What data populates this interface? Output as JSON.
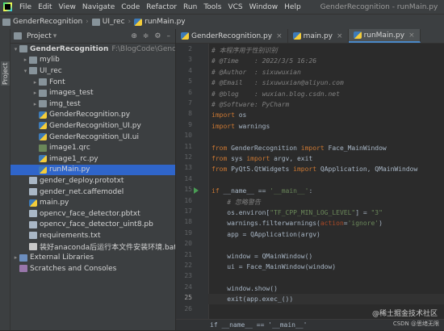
{
  "menubar": {
    "items": [
      "File",
      "Edit",
      "View",
      "Navigate",
      "Code",
      "Refactor",
      "Run",
      "Tools",
      "VCS",
      "Window",
      "Help"
    ],
    "window_title": "GenderRecognition - runMain.py"
  },
  "navbar": {
    "crumbs": [
      "GenderRecognition",
      "UI_rec",
      "runMain.py"
    ]
  },
  "side_strip": {
    "label": "Project"
  },
  "project": {
    "title": "Project",
    "root_name": "GenderRecognition",
    "root_path": "F:\\BlogCode\\GenderRecogn",
    "tree": [
      {
        "label": "mylib",
        "type": "folder",
        "indent": 2,
        "arrow": "▸"
      },
      {
        "label": "UI_rec",
        "type": "folder",
        "indent": 2,
        "arrow": "▾"
      },
      {
        "label": "Font",
        "type": "folder",
        "indent": 3,
        "arrow": "▸"
      },
      {
        "label": "images_test",
        "type": "folder",
        "indent": 3,
        "arrow": "▸"
      },
      {
        "label": "img_test",
        "type": "folder",
        "indent": 3,
        "arrow": "▸"
      },
      {
        "label": "GenderRecognition.py",
        "type": "py",
        "indent": 3,
        "arrow": ""
      },
      {
        "label": "GenderRecognition_UI.py",
        "type": "py",
        "indent": 3,
        "arrow": ""
      },
      {
        "label": "GenderRecognition_UI.ui",
        "type": "py",
        "indent": 3,
        "arrow": ""
      },
      {
        "label": "image1.qrc",
        "type": "qrc",
        "indent": 3,
        "arrow": ""
      },
      {
        "label": "image1_rc.py",
        "type": "py",
        "indent": 3,
        "arrow": ""
      },
      {
        "label": "runMain.py",
        "type": "py",
        "indent": 3,
        "arrow": "",
        "selected": true
      },
      {
        "label": "gender_deploy.prototxt",
        "type": "txt",
        "indent": 2,
        "arrow": ""
      },
      {
        "label": "gender_net.caffemodel",
        "type": "txt",
        "indent": 2,
        "arrow": ""
      },
      {
        "label": "main.py",
        "type": "py",
        "indent": 2,
        "arrow": ""
      },
      {
        "label": "opencv_face_detector.pbtxt",
        "type": "txt",
        "indent": 2,
        "arrow": ""
      },
      {
        "label": "opencv_face_detector_uint8.pb",
        "type": "txt",
        "indent": 2,
        "arrow": ""
      },
      {
        "label": "requirements.txt",
        "type": "txt",
        "indent": 2,
        "arrow": ""
      },
      {
        "label": "装好anaconda后运行本文件安装环境.bat",
        "type": "bat",
        "indent": 2,
        "arrow": ""
      },
      {
        "label": "External Libraries",
        "type": "lib",
        "indent": 1,
        "arrow": "▸"
      },
      {
        "label": "Scratches and Consoles",
        "type": "cons",
        "indent": 1,
        "arrow": ""
      }
    ]
  },
  "editor": {
    "tabs": [
      {
        "label": "GenderRecognition.py",
        "active": false
      },
      {
        "label": "main.py",
        "active": false
      },
      {
        "label": "runMain.py",
        "active": true
      }
    ],
    "lines": [
      {
        "no": "2",
        "html": "<span class='c-com'># 本程序用于性别识别</span>"
      },
      {
        "no": "3",
        "html": "<span class='c-com'># @Time    : 2022/3/5 16:26</span>"
      },
      {
        "no": "4",
        "html": "<span class='c-com'># @Author  : sixuwuxian</span>"
      },
      {
        "no": "5",
        "html": "<span class='c-com'># @Email   : sixuwuxian@aliyun.com</span>"
      },
      {
        "no": "6",
        "html": "<span class='c-com'># @blog    : wuxian.blog.csdn.net</span>"
      },
      {
        "no": "7",
        "html": "<span class='c-com'># @Software: PyCharm</span>"
      },
      {
        "no": "8",
        "html": "<span class='c-kw'>import</span> os"
      },
      {
        "no": "9",
        "html": "<span class='c-kw'>import</span> warnings"
      },
      {
        "no": "10",
        "html": ""
      },
      {
        "no": "11",
        "html": "<span class='c-kw'>from</span> GenderRecognition <span class='c-kw'>import</span> Face_MainWindow"
      },
      {
        "no": "12",
        "html": "<span class='c-kw'>from</span> sys <span class='c-kw'>import</span> argv, exit"
      },
      {
        "no": "13",
        "html": "<span class='c-kw'>from</span> PyQt5.QtWidgets <span class='c-kw'>import</span> QApplication, QMainWindow"
      },
      {
        "no": "14",
        "html": ""
      },
      {
        "no": "15",
        "html": "<span class='c-kw'>if</span> __name__ == <span class='c-str'>'__main__'</span>:",
        "run": true
      },
      {
        "no": "16",
        "html": "    <span class='c-com'># 忽略警告</span>"
      },
      {
        "no": "17",
        "html": "    os.environ[<span class='c-str'>\"TF_CPP_MIN_LOG_LEVEL\"</span>] = <span class='c-str'>\"3\"</span>"
      },
      {
        "no": "18",
        "html": "    warnings.filterwarnings(<span class='c-named'>action</span>=<span class='c-str'>'ignore'</span>)"
      },
      {
        "no": "19",
        "html": "    app = QApplication(argv)"
      },
      {
        "no": "20",
        "html": ""
      },
      {
        "no": "21",
        "html": "    window = QMainWindow()"
      },
      {
        "no": "22",
        "html": "    ui = Face_MainWindow(window)"
      },
      {
        "no": "23",
        "html": ""
      },
      {
        "no": "24",
        "html": "    window.show()"
      },
      {
        "no": "25",
        "html": "    exit(app.exec_())",
        "current": true
      },
      {
        "no": "26",
        "html": ""
      }
    ],
    "breadcrumb_bottom": "if __name__ == '__main__'"
  },
  "watermark": {
    "line1": "@稀土掘金技术社区",
    "line2": "CSDN @思绪无限"
  }
}
